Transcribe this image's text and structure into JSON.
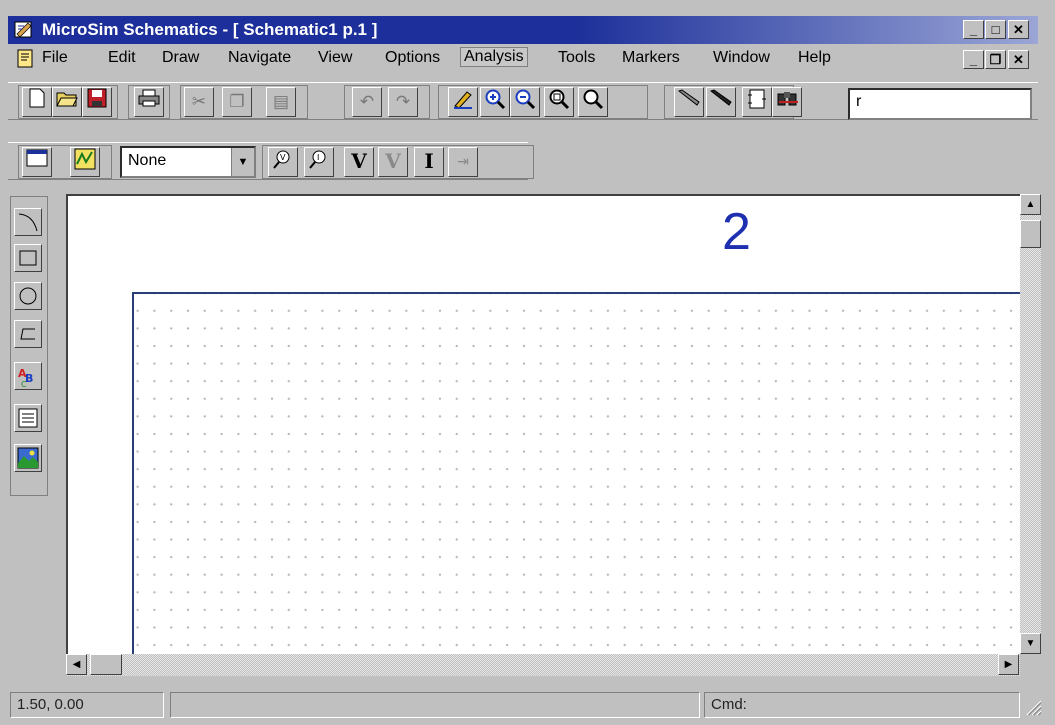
{
  "window": {
    "title": "MicroSim Schematics - [ Schematic1  p.1  ]"
  },
  "menu": [
    "File",
    "Edit",
    "Draw",
    "Navigate",
    "View",
    "Options",
    "Analysis",
    "Tools",
    "Markers",
    "Window",
    "Help"
  ],
  "toolbar": {
    "command_value": "r",
    "select_value": "None"
  },
  "toolbar2_letters": {
    "voltage": "V",
    "voltage_disabled": "V",
    "current": "I"
  },
  "canvas": {
    "page_number": "2"
  },
  "status": {
    "coordinates": "1.50, 0.00",
    "cmd_label": "Cmd:"
  }
}
